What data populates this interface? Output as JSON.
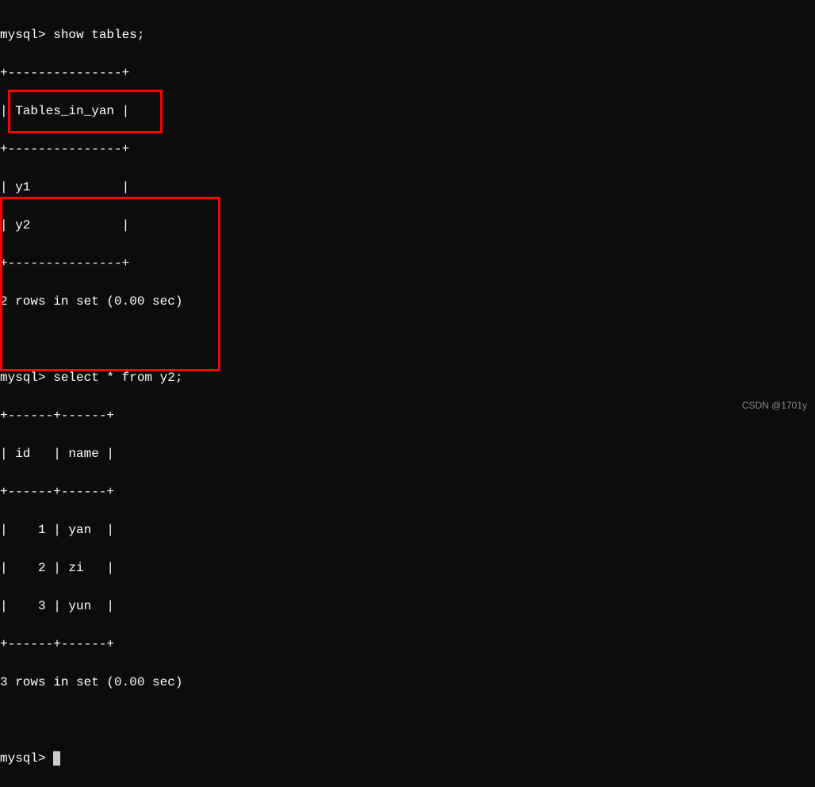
{
  "prompts": {
    "line1": "mysql> show tables;",
    "line2": "mysql> select * from y2;",
    "line3": "mysql> "
  },
  "table1": {
    "border_top": "+---------------+",
    "header": "| Tables_in_yan |",
    "border_mid": "+---------------+",
    "row1": "| y1            |",
    "row2": "| y2            |",
    "border_bot": "+---------------+",
    "summary": "2 rows in set (0.00 sec)"
  },
  "table2": {
    "border_top": "+------+------+",
    "header": "| id   | name |",
    "border_mid": "+------+------+",
    "row1": "|    1 | yan  |",
    "row2": "|    2 | zi   |",
    "row3": "|    3 | yun  |",
    "border_bot": "+------+------+",
    "summary": "3 rows in set (0.00 sec)"
  },
  "watermark": "CSDN @1701y"
}
